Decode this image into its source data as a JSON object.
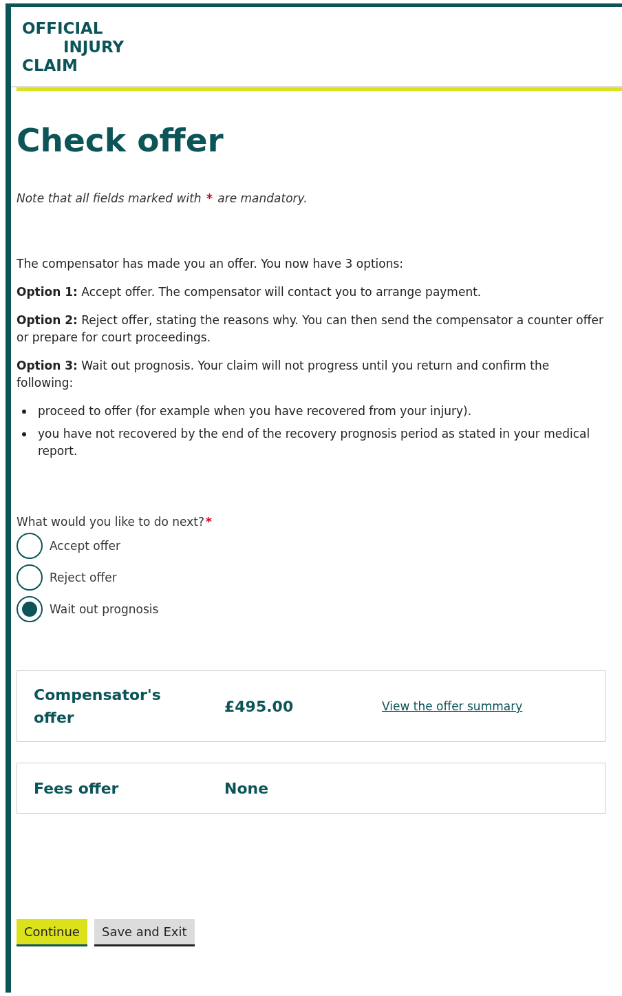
{
  "logo": {
    "lines": [
      "OFFICIAL",
      "INJURY",
      "CLAIM"
    ]
  },
  "title": "Check offer",
  "note": {
    "before": "Note that all fields marked with",
    "mark": "*",
    "after": "are mandatory."
  },
  "intro": "The compensator has made you an offer. You now have 3 options:",
  "options": [
    "**Option 1:** Accept offer. The compensator will contact you to arrange payment.",
    "**Option 2:** Reject offer, stating the reasons why. You can then send the compensator a counter offer or prepare for court proceedings.",
    "**Option 3:** Wait out prognosis. Your claim will not progress until you return and confirm the following:"
  ],
  "bullets": [
    "proceed to offer (for example when you have recovered from your injury).",
    "you have not recovered by the end of the recovery prognosis period as stated in your medical report."
  ],
  "question": {
    "label": "What would you like to do next?",
    "mark": "*"
  },
  "choices": [
    {
      "label": "Accept offer",
      "selected": false
    },
    {
      "label": "Reject offer",
      "selected": false
    },
    {
      "label": "Wait out prognosis",
      "selected": true
    }
  ],
  "offers": [
    {
      "label": "Compensator's offer",
      "amount": "£495.00",
      "link": "View the offer summary"
    },
    {
      "label": "Fees offer",
      "amount": "None"
    }
  ],
  "buttons": [
    {
      "label": "Continue",
      "kind": "primary"
    },
    {
      "label": "Save and Exit",
      "kind": "secondary"
    }
  ]
}
